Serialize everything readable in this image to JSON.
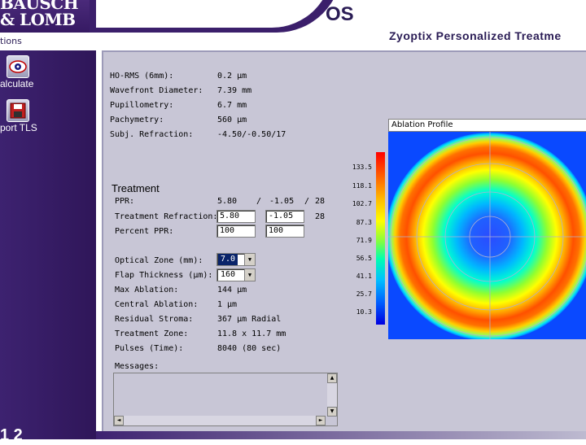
{
  "header": {
    "logo_line1": "BAUSCH",
    "logo_line2": "& LOMB",
    "eye": "OS",
    "nav_label": "tions",
    "product_title": "Zyoptix Personalized Treatme"
  },
  "sidebar": {
    "items": [
      {
        "label": "alculate",
        "icon": "calculator-eye-icon"
      },
      {
        "label": "port TLS",
        "icon": "floppy-disk-icon"
      }
    ],
    "page": "1 2"
  },
  "measurements": [
    {
      "label": "HO-RMS (6mm):",
      "value": "0.2 µm"
    },
    {
      "label": "Wavefront Diameter:",
      "value": "7.39 mm"
    },
    {
      "label": "Pupillometry:",
      "value": "6.7 mm"
    },
    {
      "label": "Pachymetry:",
      "value": "560 µm"
    },
    {
      "label": "Subj. Refraction:",
      "value": "-4.50/-0.50/17"
    }
  ],
  "treatment": {
    "title": "Treatment",
    "ppr_label": "PPR:",
    "ppr_sphere": "5.80",
    "ppr_sep1": "/",
    "ppr_cyl": "-1.05",
    "ppr_sep2": "/",
    "ppr_axis": "28",
    "refraction_label": "Treatment Refraction:",
    "refraction_sphere": "5.80",
    "refraction_cyl": "-1.05",
    "refraction_axis": "28",
    "percent_label": "Percent PPR:",
    "percent_sphere": "100",
    "percent_cyl": "100",
    "optical_zone_label": "Optical Zone (mm):",
    "optical_zone_value": "7.0",
    "flap_label": "Flap Thickness (µm):",
    "flap_value": "160",
    "results": [
      {
        "label": "Max Ablation:",
        "value": "144 µm"
      },
      {
        "label": "Central Ablation:",
        "value": "1 µm"
      },
      {
        "label": "Residual Stroma:",
        "value": "367 µm  Radial"
      },
      {
        "label": "Treatment Zone:",
        "value": "11.8 x 11.7 mm"
      },
      {
        "label": "Pulses (Time):",
        "value": "8040 (80 sec)"
      }
    ],
    "messages_label": "Messages:"
  },
  "ablation": {
    "title": "Ablation Profile",
    "scale": [
      "133.5",
      "118.1",
      "102.7",
      "87.3",
      "71.9",
      "56.5",
      "41.1",
      "25.7",
      "10.3"
    ]
  },
  "colors": {
    "brand_purple": "#3b1f6b",
    "panel_bg": "#c8c6d6"
  }
}
